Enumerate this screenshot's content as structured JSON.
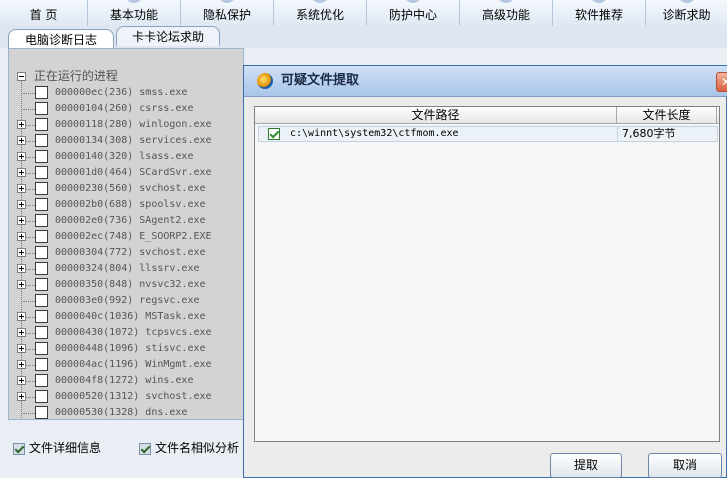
{
  "top_nav": {
    "items": [
      "首 页",
      "基本功能",
      "隐私保护",
      "系统优化",
      "防护中心",
      "高级功能",
      "软件推荐",
      "诊断求助"
    ]
  },
  "tabs": [
    "电脑诊断日志",
    "卡卡论坛求助"
  ],
  "process_tree": {
    "root_label": "正在运行的进程",
    "processes": [
      "000000ec(236) smss.exe",
      "00000104(260) csrss.exe",
      "00000118(280) winlogon.exe",
      "00000134(308) services.exe",
      "00000140(320) lsass.exe",
      "000001d0(464) SCardSvr.exe",
      "00000230(560) svchost.exe",
      "000002b0(688) spoolsv.exe",
      "000002e0(736) SAgent2.exe",
      "000002ec(748) E_SOORP2.EXE",
      "00000304(772) svchost.exe",
      "00000324(804) llssrv.exe",
      "00000350(848) nvsvc32.exe",
      "000003e0(992) regsvc.exe",
      "0000040c(1036) MSTask.exe",
      "00000430(1072) tcpsvcs.exe",
      "00000448(1096) stisvc.exe",
      "000004ac(1196) WinMgmt.exe",
      "000004f8(1272) wins.exe",
      "00000520(1312) svchost.exe",
      "00000530(1328) dns.exe"
    ]
  },
  "bottom_options": {
    "file_detail": "文件详细信息",
    "name_similarity": "文件名相似分析"
  },
  "dialog": {
    "title": "可疑文件提取",
    "columns": {
      "path": "文件路径",
      "length": "文件长度"
    },
    "rows": [
      {
        "path": "c:\\winnt\\system32\\ctfmom.exe",
        "length": "7,680字节",
        "checked": true
      }
    ],
    "buttons": {
      "extract": "提取",
      "cancel": "取消"
    }
  },
  "colors": {
    "accent": "#3b6fb0",
    "check": "#2f8a2f"
  }
}
